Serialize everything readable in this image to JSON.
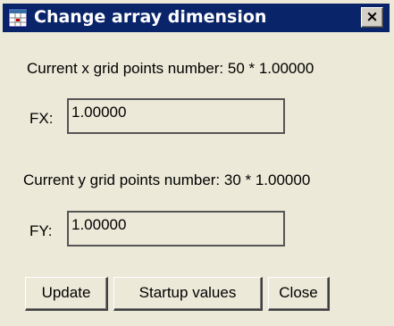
{
  "window": {
    "title": "Change array dimension",
    "close_glyph": "×"
  },
  "x_section": {
    "label": "Current x grid points number: 50 * 1.00000",
    "field_label": "FX:",
    "field_value": "1.00000"
  },
  "y_section": {
    "label": "Current y grid points number: 30 * 1.00000",
    "field_label": "FY:",
    "field_value": "1.00000"
  },
  "buttons": {
    "update": "Update",
    "startup": "Startup values",
    "close": "Close"
  },
  "colors": {
    "titlebar": "#0a246a",
    "window_bg": "#ece9d8",
    "title_text": "#ffffff"
  },
  "icons": {
    "title_icon": "grid-table-icon",
    "close_icon": "close-x-icon"
  }
}
